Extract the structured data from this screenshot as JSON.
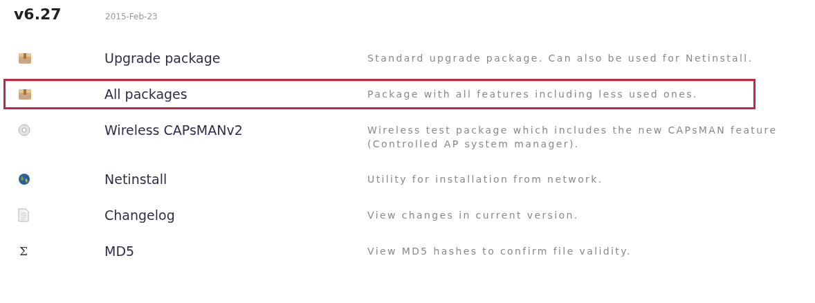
{
  "release": {
    "version": "v6.27",
    "date": "2015-Feb-23"
  },
  "downloads": [
    {
      "kind": "package",
      "name": "Upgrade package",
      "description": "Standard upgrade package. Can also be used for Netinstall.",
      "highlighted": false
    },
    {
      "kind": "package",
      "name": "All packages",
      "description": "Package with all features including less used ones.",
      "highlighted": true
    },
    {
      "kind": "disc",
      "name": "Wireless CAPsMANv2",
      "description": "Wireless test package which includes the new CAPsMAN feature (Controlled AP system manager).",
      "highlighted": false
    },
    {
      "kind": "globe",
      "name": "Netinstall",
      "description": "Utility for installation from network.",
      "highlighted": false
    },
    {
      "kind": "document",
      "name": "Changelog",
      "description": "View changes in current version.",
      "highlighted": false
    },
    {
      "kind": "symbol",
      "symbol": "Σ",
      "name": "MD5",
      "description": "View MD5 hashes to confirm file validity.",
      "highlighted": false
    }
  ]
}
